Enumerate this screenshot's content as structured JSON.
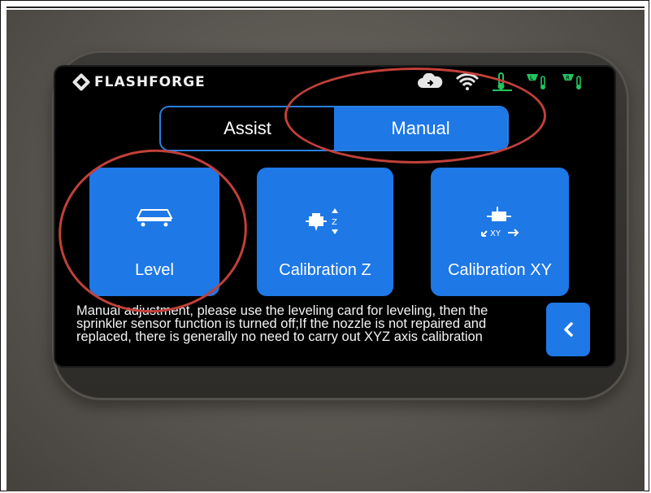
{
  "brand": {
    "name": "FLASHFORGE",
    "logo_icon": "flashforge-logo-icon"
  },
  "status_bar": {
    "icons": [
      "cloud-icon",
      "wifi-icon",
      "chamber-temp-icon",
      "left-nozzle-temp-icon",
      "right-nozzle-temp-icon"
    ],
    "nozzle_left_label": "L",
    "nozzle_right_label": "R",
    "icon_color": "#22c55e"
  },
  "mode_tabs": [
    {
      "label": "Assist",
      "selected": false
    },
    {
      "label": "Manual",
      "selected": true
    }
  ],
  "tiles": [
    {
      "label": "Level",
      "icon": "level-bed-icon"
    },
    {
      "label": "Calibration Z",
      "icon": "calibration-z-icon",
      "axis": "Z"
    },
    {
      "label": "Calibration XY",
      "icon": "calibration-xy-icon",
      "axis": "XY"
    }
  ],
  "description": "Manual adjustment, please use the leveling card for leveling, then the sprinkler sensor function is turned off;If the nozzle is not repaired and replaced, there is generally no need to carry out XYZ axis calibration",
  "back_button": {
    "icon": "chevron-left-icon"
  },
  "colors": {
    "accent": "#1e78e6",
    "annotation": "#c2403a",
    "screen": "#000000"
  }
}
